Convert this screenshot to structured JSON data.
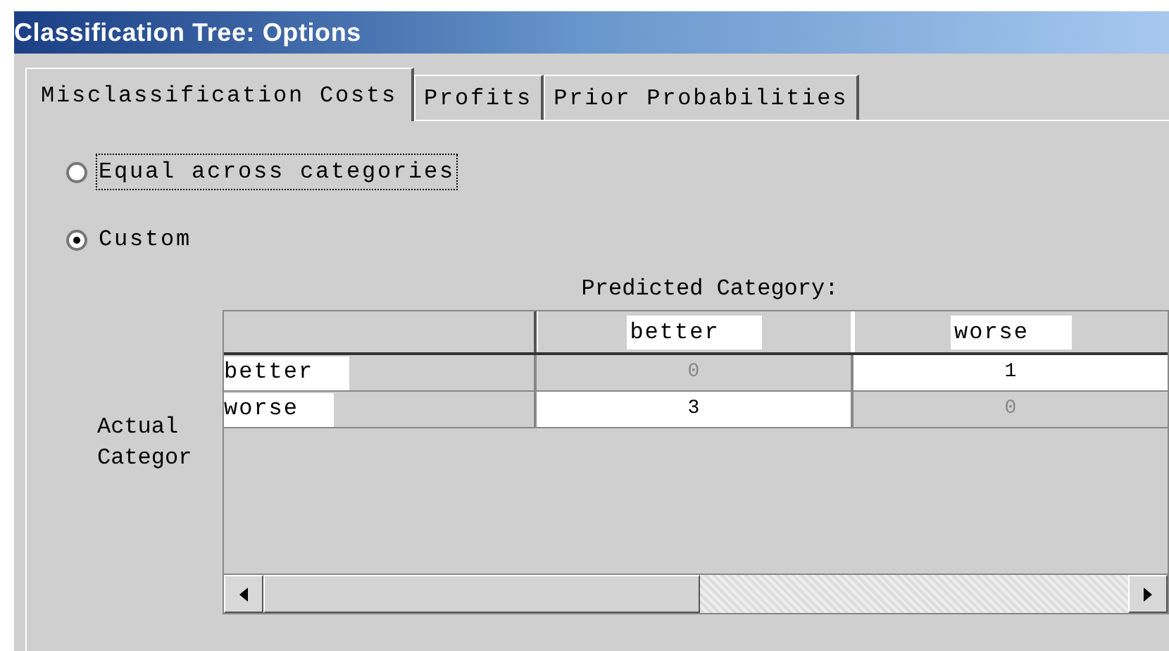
{
  "window": {
    "title": "Classification Tree: Options"
  },
  "tabs": [
    {
      "label": "Misclassification Costs",
      "selected": true
    },
    {
      "label": "Profits",
      "selected": false
    },
    {
      "label": "Prior Probabilities",
      "selected": false
    }
  ],
  "cost_options": [
    {
      "label": "Equal across categories",
      "selected": false,
      "focused": true
    },
    {
      "label": "Custom",
      "selected": true,
      "focused": false
    }
  ],
  "cost_table": {
    "column_title": "Predicted Category:",
    "row_title": "Actual Categor",
    "columns": [
      "better",
      "worse"
    ],
    "rows": [
      {
        "label": "better",
        "cells": [
          {
            "value": "0",
            "editable": false
          },
          {
            "value": "1",
            "editable": true
          }
        ]
      },
      {
        "label": "worse",
        "cells": [
          {
            "value": "3",
            "editable": true
          },
          {
            "value": "0",
            "editable": false
          }
        ]
      }
    ]
  }
}
